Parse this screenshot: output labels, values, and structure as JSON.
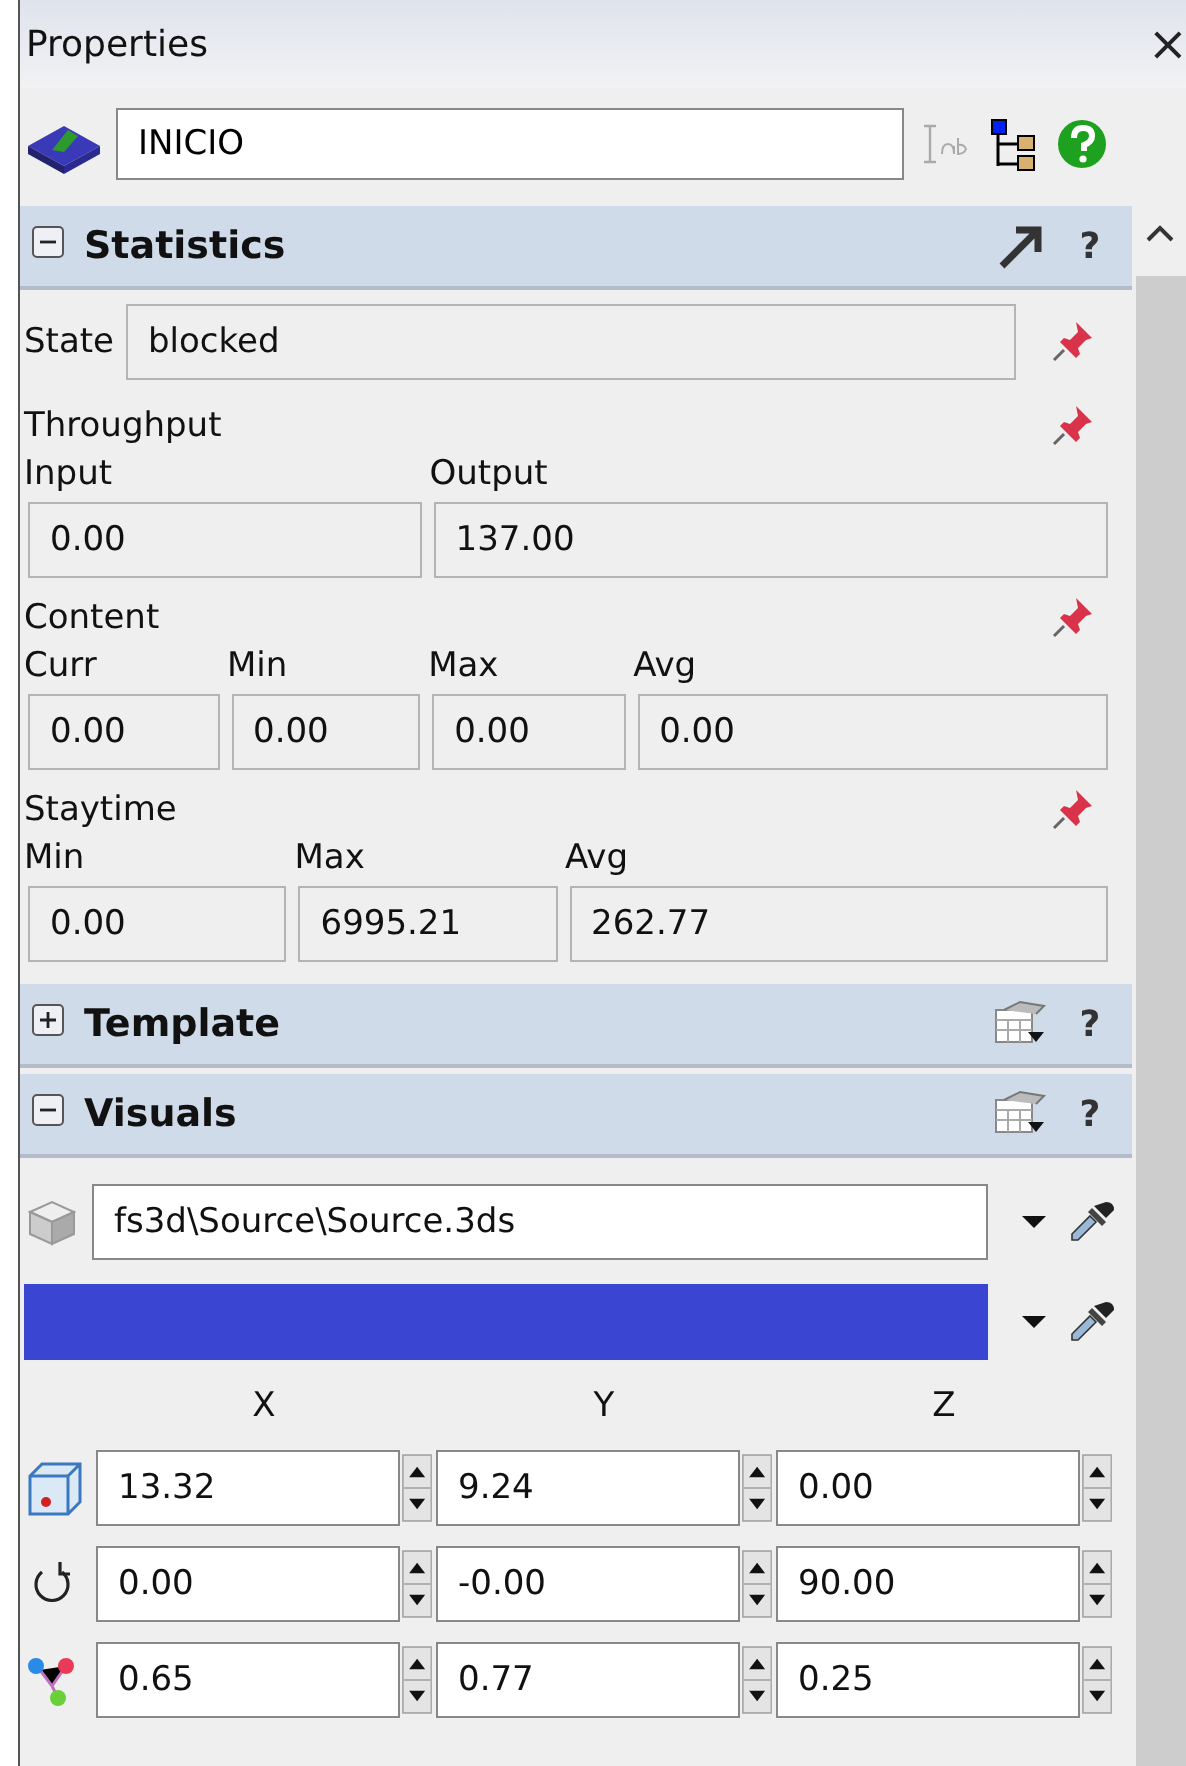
{
  "window": {
    "title": "Properties",
    "close": "×"
  },
  "object": {
    "name": "INICIO"
  },
  "sections": [
    {
      "kind": "statistics",
      "title": "Statistics",
      "expanded": true,
      "help": "?",
      "state": {
        "label": "State",
        "value": "blocked"
      },
      "groups": [
        {
          "title": "Throughput",
          "fields": [
            {
              "label": "Input",
              "value": "0.00"
            },
            {
              "label": "Output",
              "value": "137.00"
            }
          ]
        },
        {
          "title": "Content",
          "fields": [
            {
              "label": "Curr",
              "value": "0.00"
            },
            {
              "label": "Min",
              "value": "0.00"
            },
            {
              "label": "Max",
              "value": "0.00"
            },
            {
              "label": "Avg",
              "value": "0.00"
            }
          ]
        },
        {
          "title": "Staytime",
          "fields": [
            {
              "label": "Min",
              "value": "0.00"
            },
            {
              "label": "Max",
              "value": "6995.21"
            },
            {
              "label": "Avg",
              "value": "262.77"
            }
          ]
        }
      ]
    },
    {
      "kind": "template",
      "title": "Template",
      "expanded": false,
      "help": "?"
    },
    {
      "kind": "visuals",
      "title": "Visuals",
      "expanded": true,
      "help": "?",
      "shape": "fs3d\\Source\\Source.3ds",
      "color": "#3a46d2",
      "axes": [
        "X",
        "Y",
        "Z"
      ],
      "rows": [
        {
          "kind": "position",
          "values": [
            "13.32",
            "9.24",
            "0.00"
          ]
        },
        {
          "kind": "rotation",
          "values": [
            "0.00",
            "-0.00",
            "90.00"
          ]
        },
        {
          "kind": "size",
          "values": [
            "0.65",
            "0.77",
            "0.25"
          ]
        }
      ]
    }
  ]
}
